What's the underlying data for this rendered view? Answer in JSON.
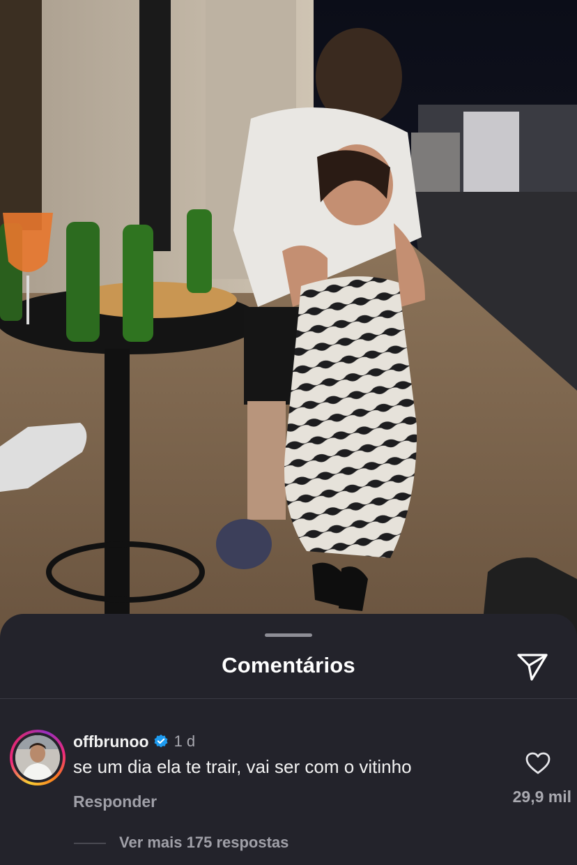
{
  "sheet": {
    "title": "Comentários",
    "share_icon": "paper-plane-icon"
  },
  "comment": {
    "username": "offbrunoo",
    "verified": true,
    "time": "1 d",
    "text": "se um dia ela te trair, vai ser com o vitinho",
    "reply_label": "Responder",
    "like_icon": "heart-outline-icon",
    "like_count": "29,9 mil",
    "more_replies": "Ver mais 175 respostas"
  },
  "colors": {
    "sheet_bg": "#23232b",
    "verified_blue": "#1d9bf0",
    "text_primary": "#f2f2f2",
    "text_secondary": "#a0a0a8"
  }
}
